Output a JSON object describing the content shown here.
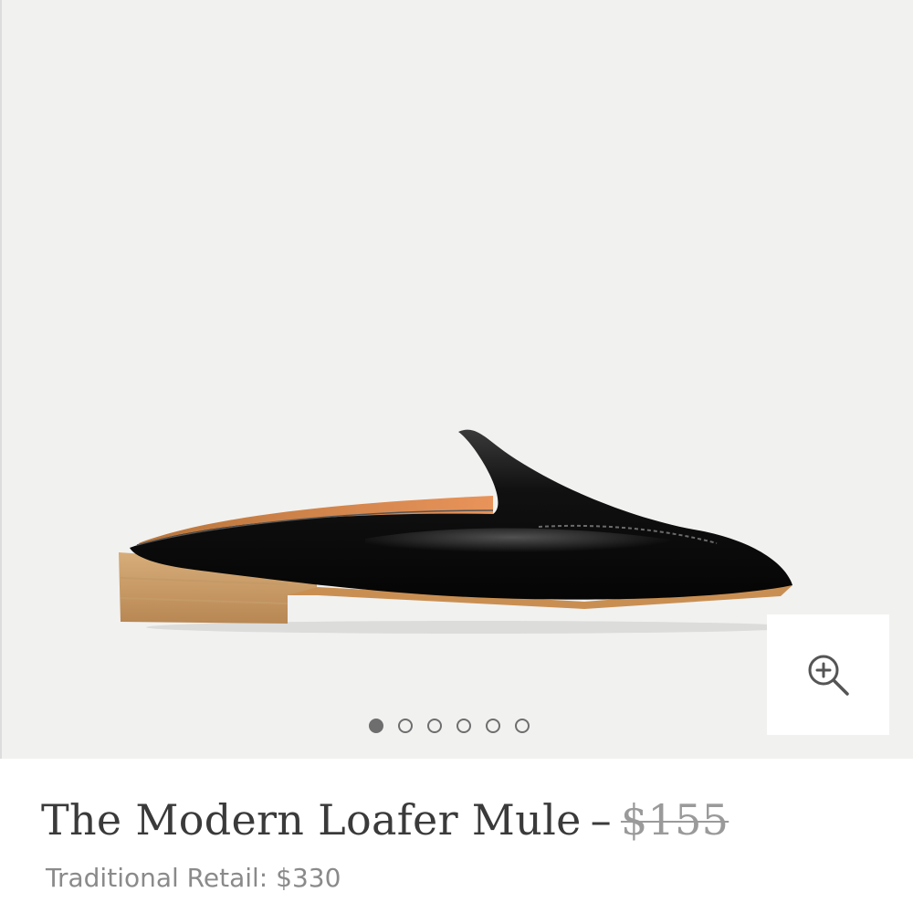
{
  "product": {
    "name": "The Modern Loafer Mule",
    "separator": "–",
    "price": "$155",
    "retail_label": "Traditional Retail:",
    "retail_price": "$330"
  },
  "gallery": {
    "image_icon": "black-leather-loafer-mule-image",
    "zoom_icon": "zoom-in-icon",
    "dots": [
      {
        "active": true
      },
      {
        "active": false
      },
      {
        "active": false
      },
      {
        "active": false
      },
      {
        "active": false
      },
      {
        "active": false
      }
    ]
  },
  "colors": {
    "gallery_background": "#f1f1f0",
    "text_primary": "#3a3a3a",
    "text_muted": "#8a8a8a",
    "strike_price": "#9a9a9a"
  }
}
